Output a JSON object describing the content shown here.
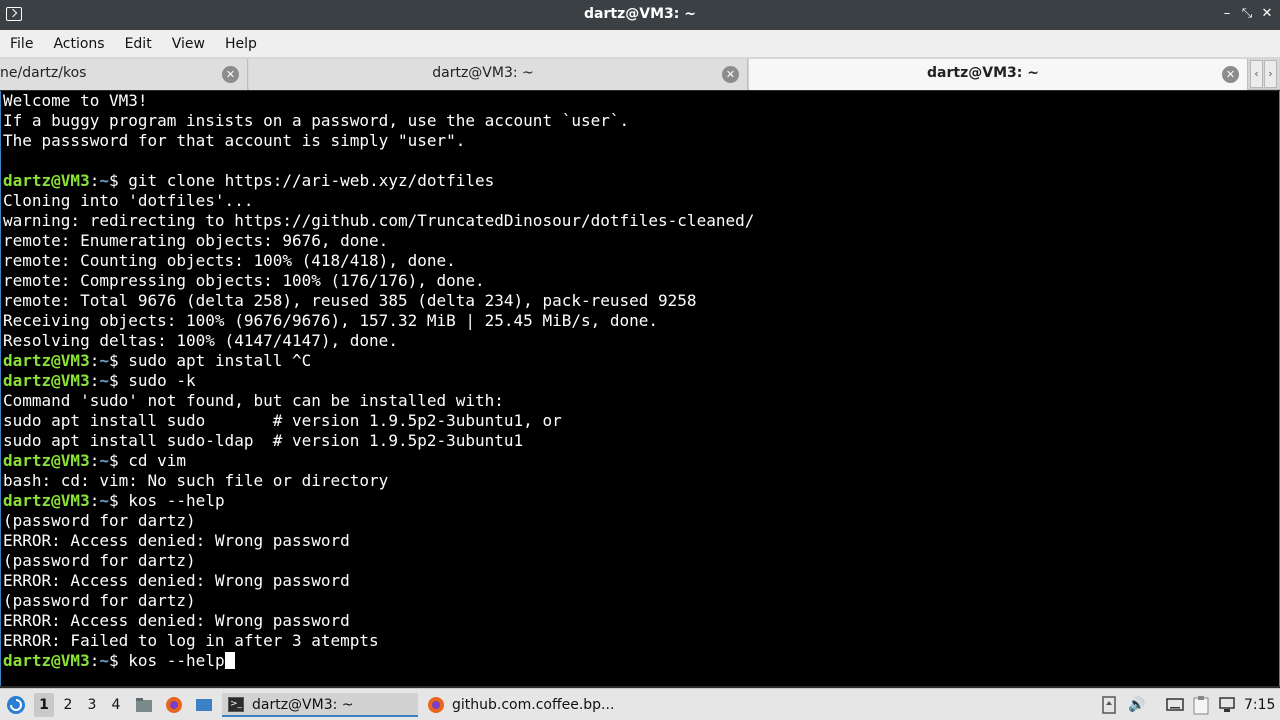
{
  "window": {
    "title": "dartz@VM3: ~"
  },
  "menu": {
    "items": [
      "File",
      "Actions",
      "Edit",
      "View",
      "Help"
    ]
  },
  "tabs": [
    {
      "label": "ne/dartz/kos",
      "active": false
    },
    {
      "label": "dartz@VM3: ~",
      "active": false
    },
    {
      "label": "dartz@VM3: ~",
      "active": true
    }
  ],
  "terminal": {
    "prompt_user": "dartz@VM3",
    "prompt_sep": ":",
    "prompt_path": "~",
    "prompt_dollar": "$ ",
    "lines": [
      {
        "type": "out",
        "text": "Welcome to VM3!"
      },
      {
        "type": "out",
        "text": "If a buggy program insists on a password, use the account `user`."
      },
      {
        "type": "out",
        "text": "The passsword for that account is simply \"user\"."
      },
      {
        "type": "out",
        "text": ""
      },
      {
        "type": "cmd",
        "text": "git clone https://ari-web.xyz/dotfiles"
      },
      {
        "type": "out",
        "text": "Cloning into 'dotfiles'..."
      },
      {
        "type": "out",
        "text": "warning: redirecting to https://github.com/TruncatedDinosour/dotfiles-cleaned/"
      },
      {
        "type": "out",
        "text": "remote: Enumerating objects: 9676, done."
      },
      {
        "type": "out",
        "text": "remote: Counting objects: 100% (418/418), done."
      },
      {
        "type": "out",
        "text": "remote: Compressing objects: 100% (176/176), done."
      },
      {
        "type": "out",
        "text": "remote: Total 9676 (delta 258), reused 385 (delta 234), pack-reused 9258"
      },
      {
        "type": "out",
        "text": "Receiving objects: 100% (9676/9676), 157.32 MiB | 25.45 MiB/s, done."
      },
      {
        "type": "out",
        "text": "Resolving deltas: 100% (4147/4147), done."
      },
      {
        "type": "cmd",
        "text": "sudo apt install ^C"
      },
      {
        "type": "cmd",
        "text": "sudo -k"
      },
      {
        "type": "out",
        "text": "Command 'sudo' not found, but can be installed with:"
      },
      {
        "type": "out",
        "text": "sudo apt install sudo       # version 1.9.5p2-3ubuntu1, or"
      },
      {
        "type": "out",
        "text": "sudo apt install sudo-ldap  # version 1.9.5p2-3ubuntu1"
      },
      {
        "type": "cmd",
        "text": "cd vim"
      },
      {
        "type": "out",
        "text": "bash: cd: vim: No such file or directory"
      },
      {
        "type": "cmd",
        "text": "kos --help"
      },
      {
        "type": "out",
        "text": "(password for dartz)"
      },
      {
        "type": "out",
        "text": "ERROR: Access denied: Wrong password"
      },
      {
        "type": "out",
        "text": "(password for dartz)"
      },
      {
        "type": "out",
        "text": "ERROR: Access denied: Wrong password"
      },
      {
        "type": "out",
        "text": "(password for dartz)"
      },
      {
        "type": "out",
        "text": "ERROR: Access denied: Wrong password"
      },
      {
        "type": "out",
        "text": "ERROR: Failed to log in after 3 atempts"
      },
      {
        "type": "cmd",
        "text": "kos --help",
        "cursor": true
      }
    ]
  },
  "taskbar": {
    "workspaces": [
      "1",
      "2",
      "3",
      "4"
    ],
    "active_workspace": "1",
    "tasks": [
      {
        "label": "dartz@VM3: ~",
        "icon": "terminal-icon",
        "active": true
      },
      {
        "label": "github.com.coffee.bp...",
        "icon": "firefox-icon",
        "active": false
      }
    ],
    "clock": "7:15"
  },
  "colors": {
    "prompt_user": "#8ae234",
    "prompt_path": "#729fcf",
    "terminal_bg": "#000000",
    "titlebar_bg": "#3b4045"
  }
}
